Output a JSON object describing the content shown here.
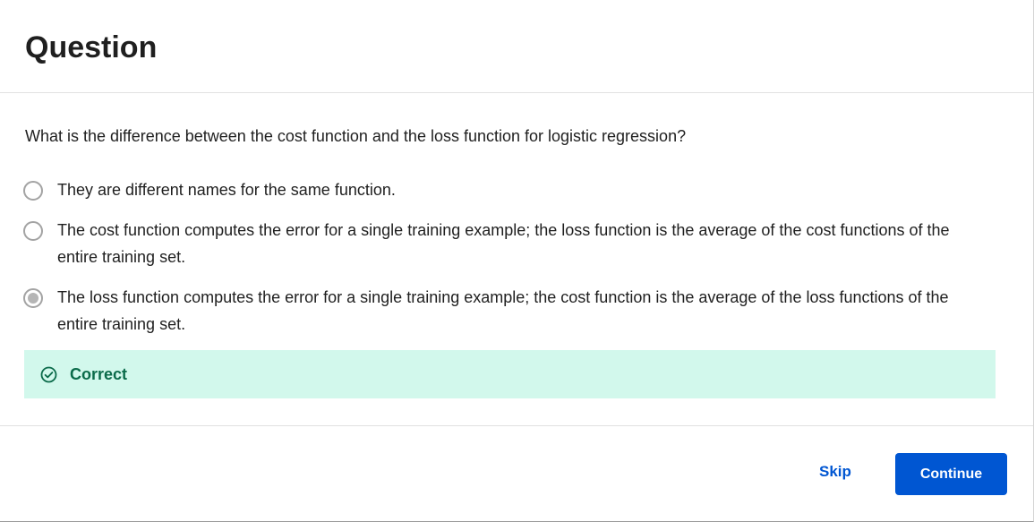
{
  "header": {
    "title": "Question"
  },
  "question": {
    "text": "What is the difference between the cost function and the loss function for logistic regression?",
    "options": [
      {
        "label": "They are different names for the same function.",
        "selected": false
      },
      {
        "label": "The cost function computes the error for a single training example; the loss function is the average of the cost functions of the entire training set.",
        "selected": false
      },
      {
        "label": "The loss function computes the error for a single training example; the cost function is the average of the loss functions of the entire training set.",
        "selected": true
      }
    ]
  },
  "feedback": {
    "icon": "check-circle-icon",
    "text": "Correct",
    "background_color": "#d2f8ec",
    "text_color": "#0b6b4a"
  },
  "footer": {
    "skip_label": "Skip",
    "continue_label": "Continue",
    "accent_color": "#0056d2"
  }
}
